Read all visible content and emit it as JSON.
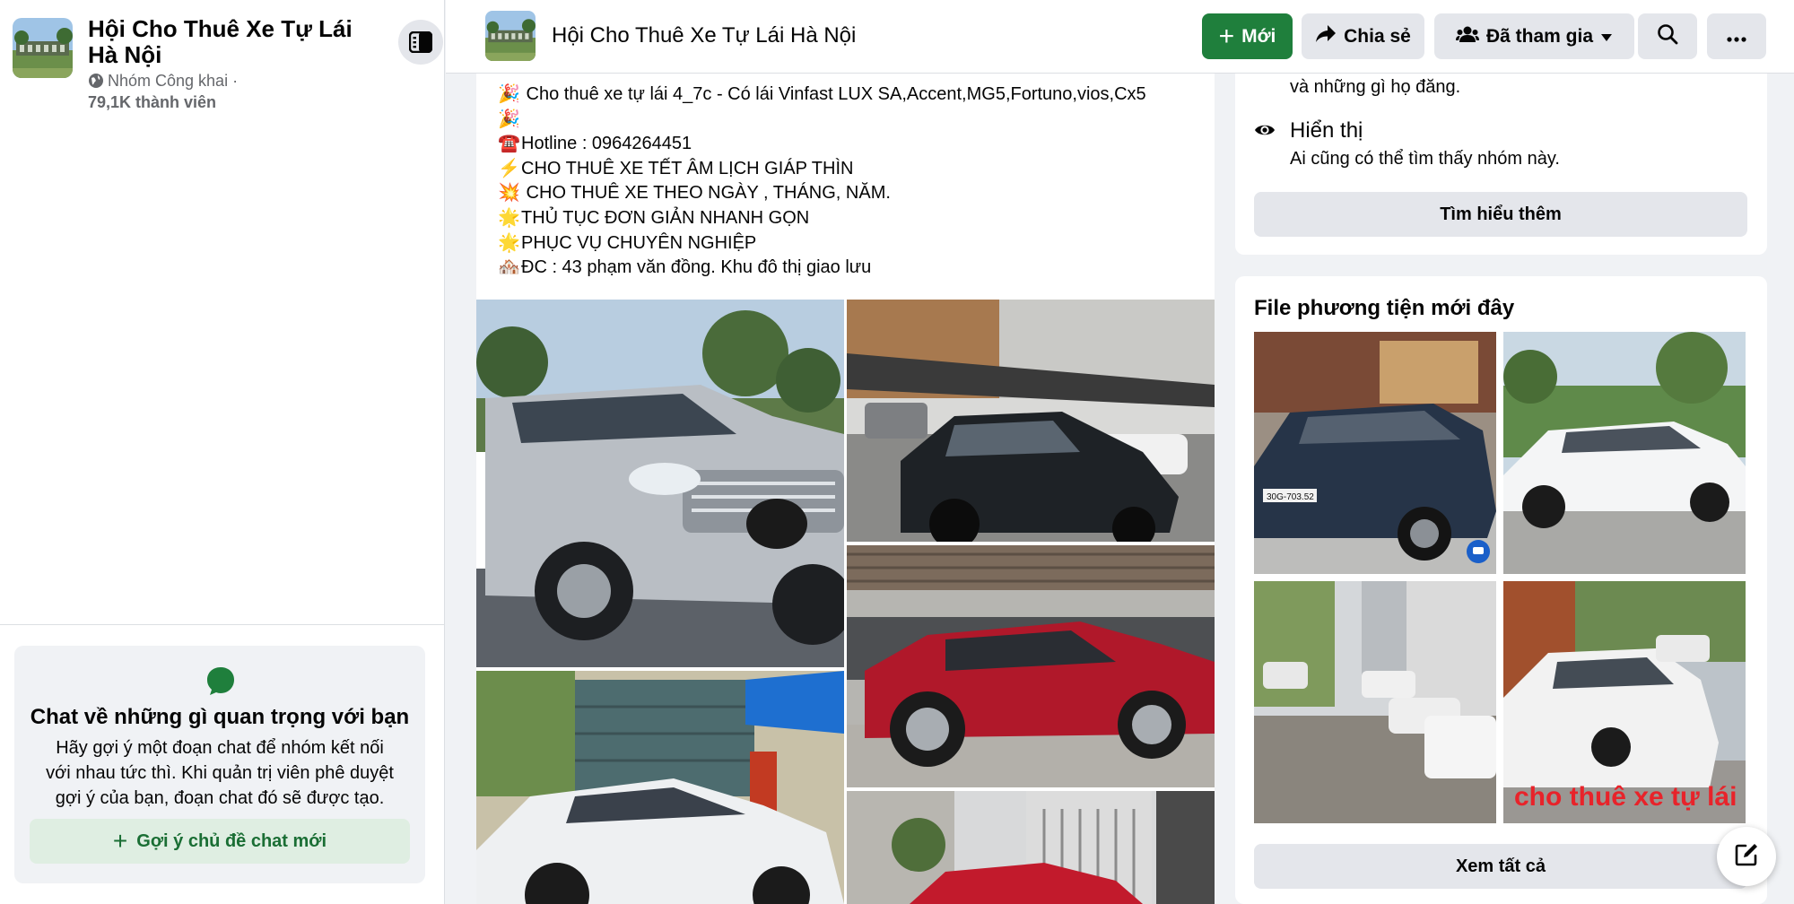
{
  "group": {
    "name": "Hội Cho Thuê Xe Tự Lái Hà Nội",
    "privacy": "Nhóm Công khai ·",
    "members": "79,1K thành viên"
  },
  "header": {
    "title": "Hội Cho Thuê Xe Tự Lái Hà Nội",
    "new_label": "Mới",
    "share_label": "Chia sẻ",
    "joined_label": "Đã tham gia"
  },
  "chat_card": {
    "title": "Chat về những gì quan trọng với bạn",
    "desc_lines": [
      "Hãy gợi ý một đoạn chat để nhóm kết nối",
      "với nhau tức thì. Khi quản trị viên phê duyệt",
      "gợi ý của bạn, đoạn chat đó sẽ được tạo."
    ],
    "button_label": "Gợi ý chủ đề chat mới"
  },
  "post": {
    "lines": [
      {
        "emoji": "🎉",
        "text": " Cho thuê xe tự lái 4_7c - Có lái Vinfast LUX SA,Accent,MG5,Fortuno,vios,Cx5"
      },
      {
        "emoji": "🎉",
        "text": ""
      },
      {
        "emoji": "☎️",
        "text": "Hotline : 0964264451"
      },
      {
        "emoji": "⚡",
        "text": "CHO THUÊ XE TẾT ÂM LỊCH GIÁP THÌN"
      },
      {
        "emoji": "💥",
        "text": " CHO THUÊ XE THEO NGÀY , THÁNG, NĂM."
      },
      {
        "emoji": "🌟",
        "text": "THỦ TỤC  ĐƠN GIẢN NHANH GỌN"
      },
      {
        "emoji": "🌟",
        "text": "PHỤC VỤ CHUYÊN NGHIỆP"
      },
      {
        "emoji": "🏘️",
        "text": "ĐC : 43 phạm văn đồng. Khu đô thị giao lưu"
      }
    ],
    "photos": [
      {
        "name": "silver-suv-photo",
        "car_color": "#b9bec4"
      },
      {
        "name": "black-suv-photo",
        "car_color": "#1e2226"
      },
      {
        "name": "red-suv-photo",
        "car_color": "#b0182a"
      },
      {
        "name": "white-sedan-photo",
        "car_color": "#eef0f2"
      },
      {
        "name": "red-car-street-photo",
        "car_color": "#c21a2c"
      }
    ]
  },
  "about": {
    "truncated_text": "và những gì họ đăng.",
    "visibility_title": "Hiển thị",
    "visibility_desc": "Ai cũng có thể tìm thấy nhóm này.",
    "learn_more_label": "Tìm hiểu thêm"
  },
  "media": {
    "title": "File phương tiện mới đây",
    "see_all_label": "Xem tất cả",
    "thumbs": [
      {
        "name": "dark-sedan-thumb",
        "car_color": "#263448",
        "plate": "30G-703.52"
      },
      {
        "name": "white-sedan-thumb",
        "car_color": "#f4f5f6"
      },
      {
        "name": "street-parking-thumb",
        "car_color": "#e8e8e8"
      },
      {
        "name": "white-peugeot-thumb",
        "car_color": "#f2f2f2",
        "overlay_text": "cho thuê xe tự lái"
      }
    ]
  },
  "colors": {
    "accent_green": "#1f7f3c",
    "button_grey": "#e4e6eb",
    "page_bg": "#f0f2f5"
  }
}
